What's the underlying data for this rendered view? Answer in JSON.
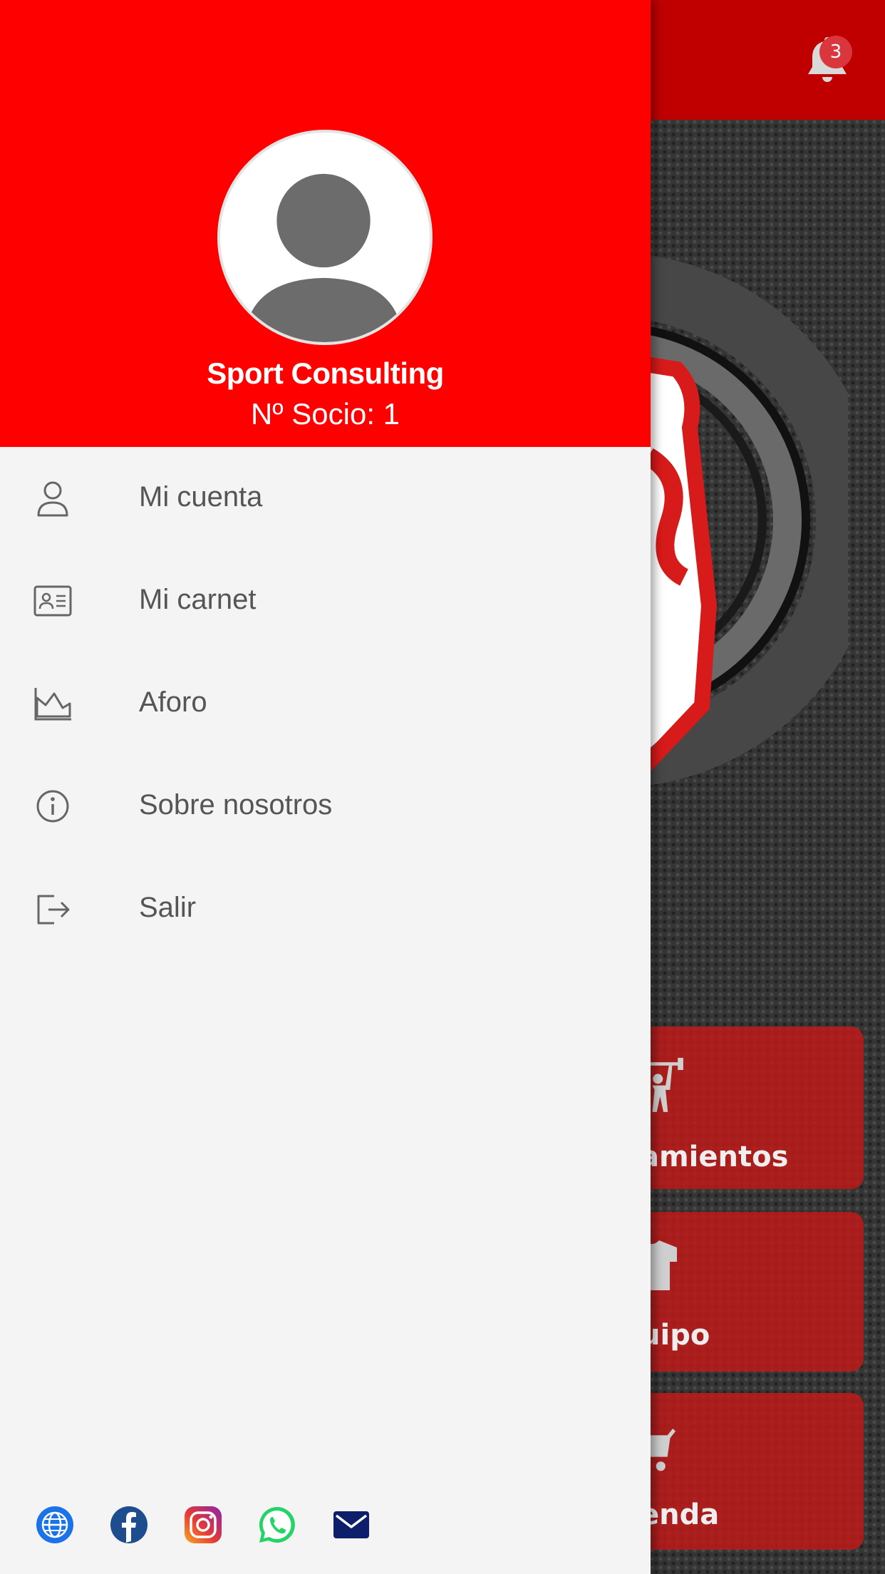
{
  "colors": {
    "drawer_header": "#ff0000",
    "app_header": "#c00000",
    "drawer_bg": "#f4f4f4",
    "menu_text": "#555555",
    "tile_bg": "#c41818",
    "badge_bg": "#d9363e"
  },
  "header": {
    "notification_icon": "bell-icon",
    "notification_count": "3"
  },
  "drawer": {
    "avatar_icon": "user-avatar-icon",
    "user_name": "Sport Consulting",
    "member_number": "Nº Socio: 1",
    "menu": [
      {
        "label": "Mi cuenta",
        "icon": "user-icon"
      },
      {
        "label": "Mi carnet",
        "icon": "id-card-icon"
      },
      {
        "label": "Aforo",
        "icon": "area-chart-icon"
      },
      {
        "label": "Sobre nosotros",
        "icon": "info-icon"
      },
      {
        "label": "Salir",
        "icon": "logout-icon"
      }
    ],
    "social": [
      {
        "icon": "globe-icon"
      },
      {
        "icon": "facebook-icon"
      },
      {
        "icon": "instagram-icon"
      },
      {
        "icon": "whatsapp-icon"
      },
      {
        "icon": "mail-icon"
      }
    ]
  },
  "background_tiles": [
    {
      "label": "amientos",
      "icon": "weightlifter-icon"
    },
    {
      "label": "uipo",
      "icon": "tshirt-icon"
    },
    {
      "label": "enda",
      "icon": "cart-icon"
    }
  ]
}
